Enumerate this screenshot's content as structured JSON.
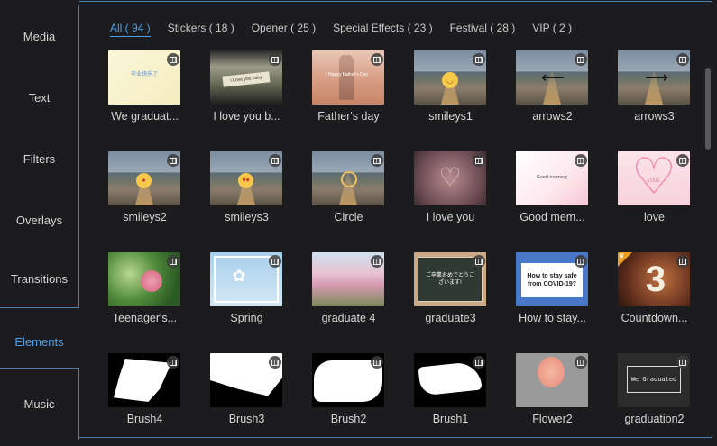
{
  "sidebar": {
    "items": [
      {
        "label": "Media",
        "active": false
      },
      {
        "label": "Text",
        "active": false
      },
      {
        "label": "Filters",
        "active": false
      },
      {
        "label": "Overlays",
        "active": false
      },
      {
        "label": "Transitions",
        "active": false
      },
      {
        "label": "Elements",
        "active": true
      },
      {
        "label": "Music",
        "active": false
      }
    ]
  },
  "tabs": [
    {
      "label": "All ( 94 )",
      "active": true
    },
    {
      "label": "Stickers ( 18 )",
      "active": false
    },
    {
      "label": "Opener ( 25 )",
      "active": false
    },
    {
      "label": "Special Effects ( 23 )",
      "active": false
    },
    {
      "label": "Festival ( 28 )",
      "active": false
    },
    {
      "label": "VIP ( 2 )",
      "active": false
    }
  ],
  "colors": {
    "accent": "#4b9ee8",
    "background": "#1c1c1e",
    "border": "#4a7fb8",
    "vip_badge": "#f0a020"
  },
  "items": [
    {
      "caption": "We graduat...",
      "icon": "film-icon",
      "thumb": "we-graduated",
      "thumb_text": "毕业快乐了"
    },
    {
      "caption": "I love you b...",
      "icon": "film-icon",
      "thumb": "love-you-hills",
      "thumb_text": "I Love you baby"
    },
    {
      "caption": "Father's day",
      "icon": "film-icon",
      "thumb": "fathers-day",
      "thumb_text": "Happy Father's Day"
    },
    {
      "caption": "smileys1",
      "icon": "film-icon",
      "thumb": "road-smiley"
    },
    {
      "caption": "arrows2",
      "icon": "film-icon",
      "thumb": "road-arrow-left"
    },
    {
      "caption": "arrows3",
      "icon": "film-icon",
      "thumb": "road-arrow-right"
    },
    {
      "caption": "smileys2",
      "icon": "film-icon",
      "thumb": "road-smiley2"
    },
    {
      "caption": "smileys3",
      "icon": "film-icon",
      "thumb": "road-heart-eyes"
    },
    {
      "caption": "Circle",
      "icon": "film-icon",
      "thumb": "road-circle"
    },
    {
      "caption": "I love you",
      "icon": "film-icon",
      "thumb": "i-love-you-heart"
    },
    {
      "caption": "Good mem...",
      "icon": "film-icon",
      "thumb": "good-memory",
      "thumb_text": "Good memory"
    },
    {
      "caption": "love",
      "icon": "film-icon",
      "thumb": "love-heart",
      "thumb_text": "LOVE"
    },
    {
      "caption": "Teenager's...",
      "icon": "film-icon",
      "thumb": "teenager-leaves"
    },
    {
      "caption": "Spring",
      "icon": "film-icon",
      "thumb": "spring-flower"
    },
    {
      "caption": "graduate 4",
      "icon": "film-icon",
      "thumb": "sakura"
    },
    {
      "caption": "graduate3",
      "icon": "film-icon",
      "thumb": "chalkboard",
      "thumb_text": "ご卒業おめでとうございます!"
    },
    {
      "caption": "How to stay...",
      "icon": "film-icon",
      "thumb": "covid-note",
      "thumb_text": "How to stay safe from COVID-19?"
    },
    {
      "caption": "Countdown...",
      "icon": "film-icon",
      "thumb": "countdown",
      "thumb_text": "3",
      "vip": true
    },
    {
      "caption": "Brush4",
      "icon": "film-icon",
      "thumb": "brush4"
    },
    {
      "caption": "Brush3",
      "icon": "film-icon",
      "thumb": "brush3"
    },
    {
      "caption": "Brush2",
      "icon": "film-icon",
      "thumb": "brush2"
    },
    {
      "caption": "Brush1",
      "icon": "film-icon",
      "thumb": "brush1"
    },
    {
      "caption": "Flower2",
      "icon": "film-icon",
      "thumb": "flower-paw"
    },
    {
      "caption": "graduation2",
      "icon": "film-icon",
      "thumb": "graduation-frame",
      "thumb_text": "We Graduated"
    }
  ]
}
